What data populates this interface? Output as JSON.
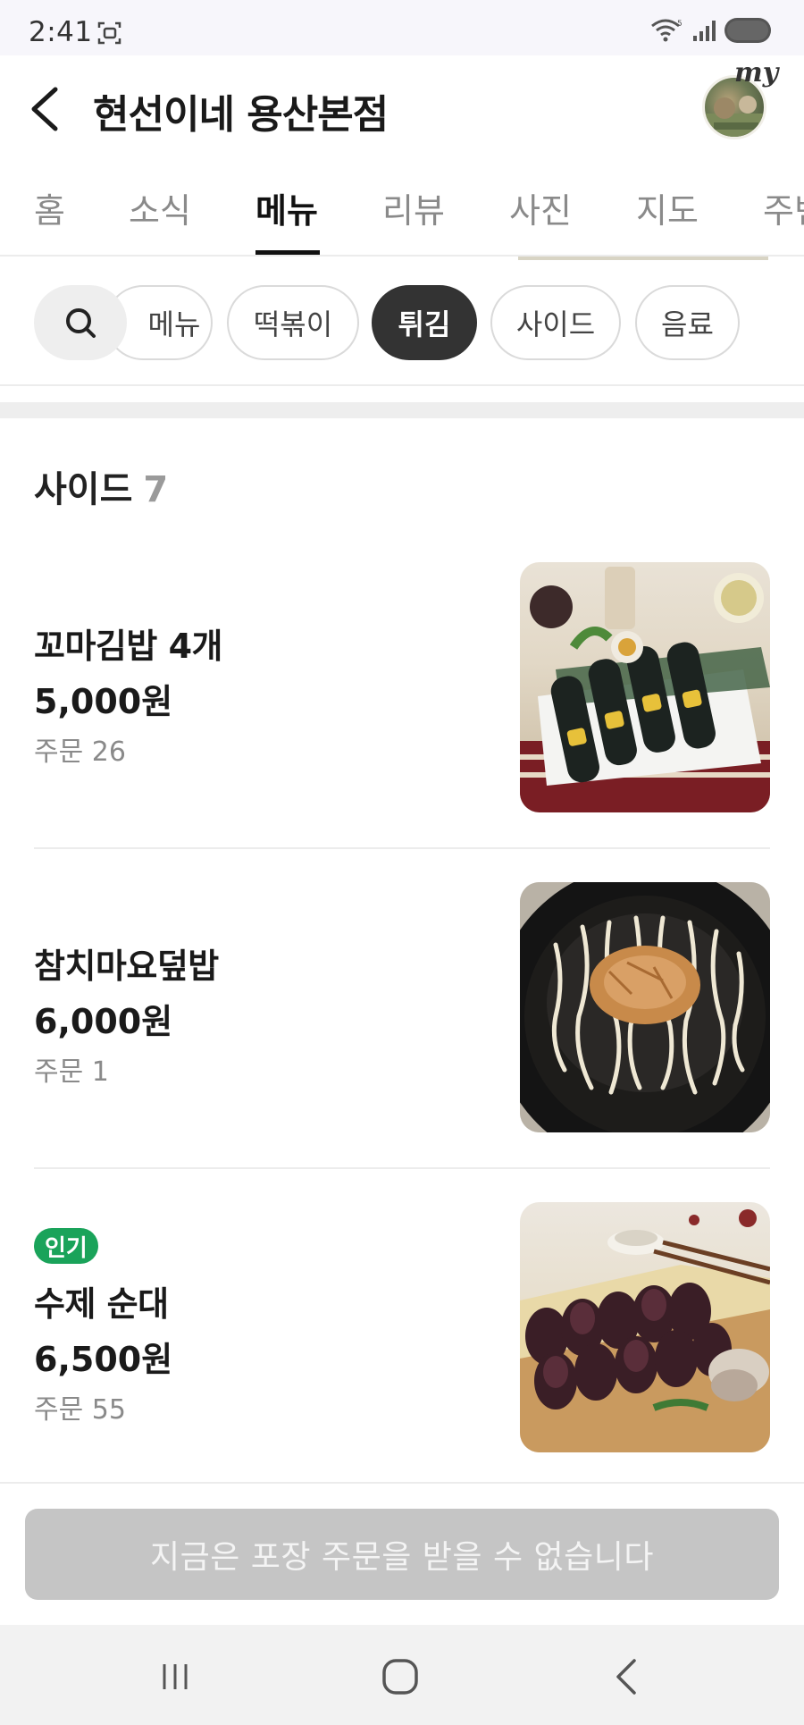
{
  "status_bar": {
    "time": "2:41",
    "icons": [
      "screenshot-icon",
      "wifi-icon",
      "signal-icon",
      "battery-icon"
    ]
  },
  "header": {
    "store_name": "현선이네 용산본점",
    "avatar_label": "my",
    "icons": [
      "back-arrow-icon"
    ]
  },
  "tabs": {
    "items": [
      "홈",
      "소식",
      "메뉴",
      "리뷰",
      "사진",
      "지도",
      "주변"
    ],
    "active": "메뉴"
  },
  "category_chips": {
    "items": [
      "메뉴",
      "떡볶이",
      "튀김",
      "사이드",
      "음료"
    ],
    "active": "튀김",
    "search_icon": "search-icon"
  },
  "section": {
    "title": "사이드",
    "count": "7"
  },
  "menu_items": [
    {
      "name": "꼬마김밥 4개",
      "price": "5,000원",
      "orders": "주문 26",
      "badge": ""
    },
    {
      "name": "참치마요덮밥",
      "price": "6,000원",
      "orders": "주문 1",
      "badge": ""
    },
    {
      "name": "수제 순대",
      "price": "6,500원",
      "orders": "주문 55",
      "badge": "인기"
    }
  ],
  "cta": {
    "label": "지금은 포장 주문을 받을 수 없습니다",
    "enabled": false
  },
  "nav_bar": {
    "icons": [
      "recent-apps-icon",
      "home-icon",
      "back-icon"
    ]
  },
  "colors": {
    "badge_green": "#1aa35a",
    "chip_active": "#333333",
    "cta_disabled": "#c5c5c5"
  }
}
